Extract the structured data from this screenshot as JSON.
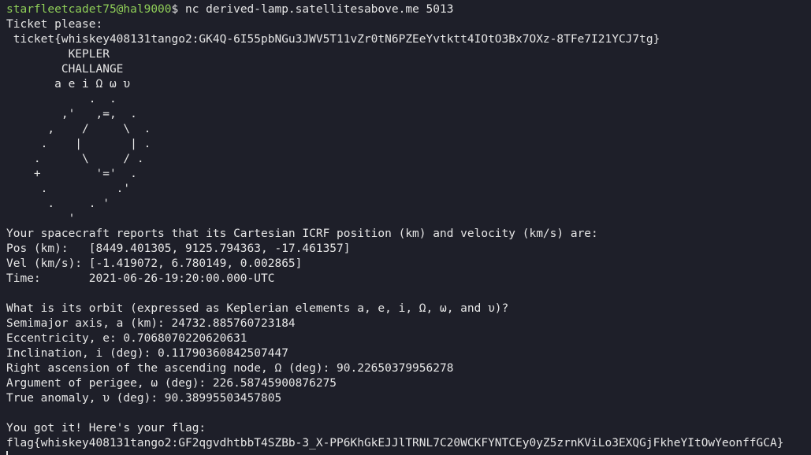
{
  "prompt": {
    "user_host": "starfleetcadet75@hal9000",
    "symbol": "$ ",
    "command": "nc derived-lamp.satellitesabove.me 5013"
  },
  "ticket": {
    "prompt": "Ticket please:",
    "value": " ticket{whiskey408131tango2:GK4Q-6I55pbNGu3JWV5T11vZr0tN6PZEeYvtktt4IOtO3Bx7OXz-8TFe7I21YCJ7tg}"
  },
  "banner": [
    "         KEPLER",
    "        CHALLANGE",
    "       a e i Ω ω υ",
    "            .  .",
    "        ,'   ,=,  .",
    "      ,    /     \\  .",
    "     .    |       | .",
    "    .      \\     / .",
    "    +        '='  .",
    "     .          .'",
    "      .     . '",
    "         '"
  ],
  "report": {
    "intro": "Your spacecraft reports that its Cartesian ICRF position (km) and velocity (km/s) are:",
    "pos": "Pos (km):   [8449.401305, 9125.794363, -17.461357]",
    "vel": "Vel (km/s): [-1.419072, 6.780149, 0.002865]",
    "time": "Time:       2021-06-26-19:20:00.000-UTC"
  },
  "question": {
    "prompt": "What is its orbit (expressed as Keplerian elements a, e, i, Ω, ω, and υ)?",
    "answers": [
      "Semimajor axis, a (km): 24732.885760723184",
      "Eccentricity, e: 0.7068070220620631",
      "Inclination, i (deg): 0.11790360842507447",
      "Right ascension of the ascending node, Ω (deg): 90.22650379956278",
      "Argument of perigee, ω (deg): 226.58745900876275",
      "True anomaly, υ (deg): 90.38995503457805"
    ]
  },
  "result": {
    "message": "You got it! Here's your flag:",
    "flag": "flag{whiskey408131tango2:GF2qgvdhtbbT4SZBb-3_X-PP6KhGkEJJlTRNL7C20WCKFYNTCEy0yZ5zrnKViLo3EXQGjFkheYItOwYeonffGCA}"
  },
  "colors": {
    "background": "#1e1f29",
    "foreground": "#e6e6e6",
    "prompt_user": "#8fce58"
  }
}
